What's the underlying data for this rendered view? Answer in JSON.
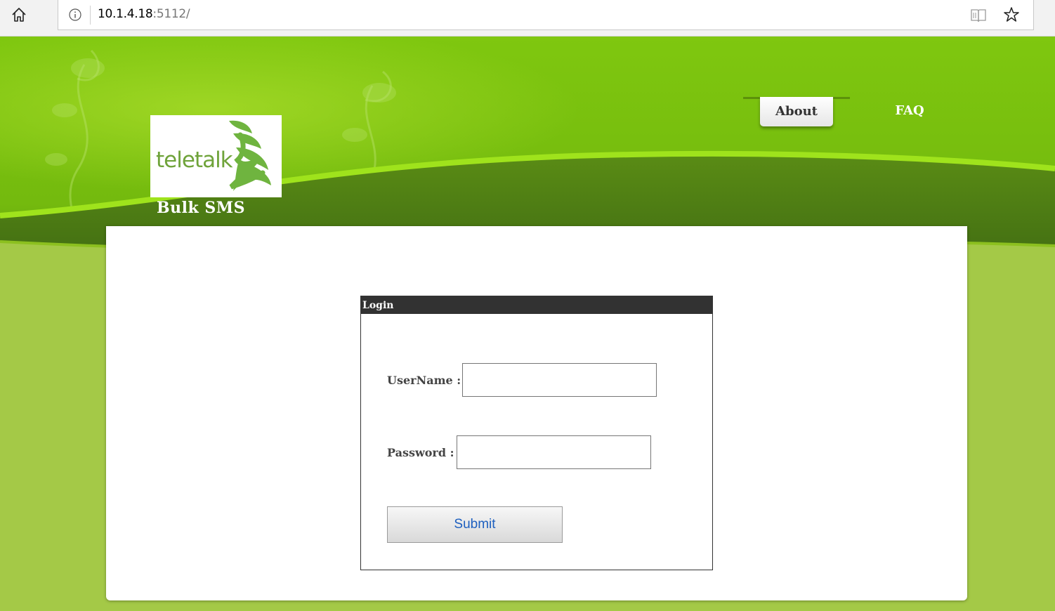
{
  "browser": {
    "url_host": "10.1.4.18",
    "url_port_path": ":5112/"
  },
  "header": {
    "logo_text": "teletalk",
    "brand_subtitle": "Bulk SMS",
    "nav": [
      {
        "label": "About",
        "active": true
      },
      {
        "label": "FAQ",
        "active": false
      }
    ]
  },
  "login": {
    "title": "Login",
    "username_label": "UserName :",
    "username_value": "",
    "password_label": "Password :",
    "password_value": "",
    "submit_label": "Submit"
  },
  "colors": {
    "header_green_light": "#8fd21a",
    "header_green_dark": "#4f7d16",
    "background_green": "#a4c947",
    "logo_green": "#6fb43f",
    "login_header_bg": "#323232",
    "submit_text": "#1d5fbf"
  },
  "icons": {
    "home": "home-icon",
    "site_info": "info-icon",
    "reading_view": "reading-view-icon",
    "favorite": "star-icon",
    "logo_mark": "teletalk-logo-mark"
  }
}
